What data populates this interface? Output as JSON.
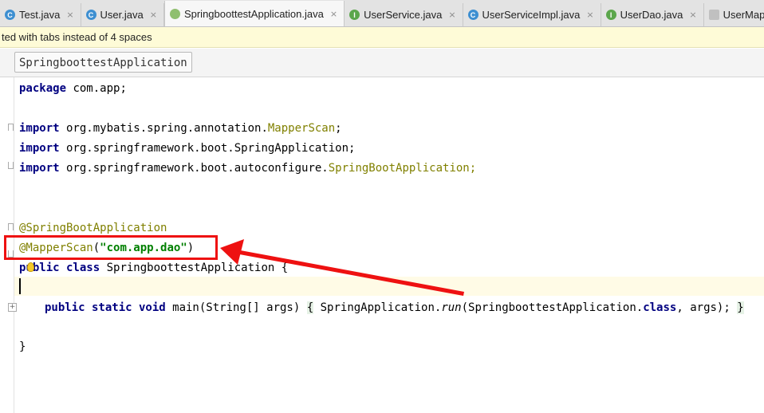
{
  "tabs": [
    {
      "label": "Test.java",
      "icon": "class-icon",
      "icon_letter": "C",
      "active": false
    },
    {
      "label": "User.java",
      "icon": "class-icon",
      "icon_letter": "C",
      "active": false
    },
    {
      "label": "SpringboottestApplication.java",
      "icon": "spring-boot-icon",
      "icon_letter": "",
      "active": true
    },
    {
      "label": "UserService.java",
      "icon": "interface-icon",
      "icon_letter": "I",
      "active": false
    },
    {
      "label": "UserServiceImpl.java",
      "icon": "class-icon",
      "icon_letter": "C",
      "active": false
    },
    {
      "label": "UserDao.java",
      "icon": "interface-icon",
      "icon_letter": "I",
      "active": false
    },
    {
      "label": "UserMap",
      "icon": "xml-mapper-icon",
      "icon_letter": "",
      "active": false
    }
  ],
  "tab_close_glyph": "×",
  "notification": {
    "text": "ted with tabs instead of 4 spaces"
  },
  "breadcrumb": {
    "label": "SpringboottestApplication"
  },
  "code": {
    "package_kw": "package",
    "package_name": " com.app;",
    "imports": [
      {
        "kw": "import",
        "plain": " org.mybatis.spring.annotation.",
        "cls": "MapperScan",
        "tail": ";"
      },
      {
        "kw": "import",
        "plain": " org.springframework.boot.SpringApplication;",
        "cls": "",
        "tail": ""
      },
      {
        "kw": "import",
        "plain": " org.springframework.boot.autoconfigure.",
        "cls": "SpringBootApplication",
        "tail": ";"
      }
    ],
    "annotation1": "@SpringBootApplication",
    "annotation2_name": "@MapperScan",
    "annotation2_open": "(",
    "annotation2_arg": "\"com.app.dao\"",
    "annotation2_close": ")",
    "class_kw": "public class",
    "class_name": " SpringboottestApplication {",
    "main_kw": "public static void",
    "main_sig": " main(String[] args) ",
    "main_lbrace": "{",
    "main_body_pre": " SpringApplication.",
    "main_body_run": "run",
    "main_body_mid": "(SpringboottestApplication.",
    "main_body_class": "class",
    "main_body_post": ", args); ",
    "main_rbrace": "}",
    "closing": "}"
  },
  "colors": {
    "annotation_box": "#ee1111",
    "arrow": "#ee1111",
    "keyword": "#000080",
    "annotation": "#808000",
    "string": "#008000"
  }
}
